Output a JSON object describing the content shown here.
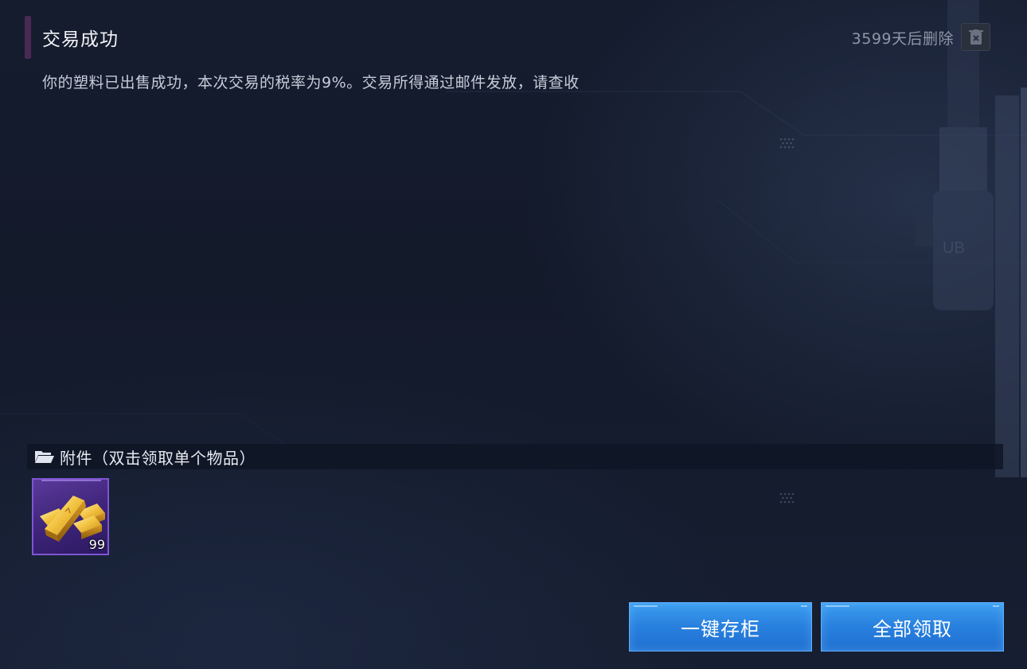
{
  "mail": {
    "title": "交易成功",
    "expire_text": "3599天后删除",
    "message": "你的塑料已出售成功，本次交易的税率为9%。交易所得通过邮件发放，请查收"
  },
  "attachments": {
    "label": "附件（双击领取单个物品）",
    "items": [
      {
        "name": "gold-bars",
        "count": "99",
        "rarity_color": "#5a3a9a"
      }
    ]
  },
  "actions": {
    "store_all_label": "一键存柜",
    "claim_all_label": "全部领取"
  },
  "icons": {
    "delete": "trash-icon",
    "folder": "folder-open-icon"
  },
  "colors": {
    "accent": "#2880de",
    "title_bar": "#4a2a55",
    "rarity_purple": "#7f55d0"
  }
}
